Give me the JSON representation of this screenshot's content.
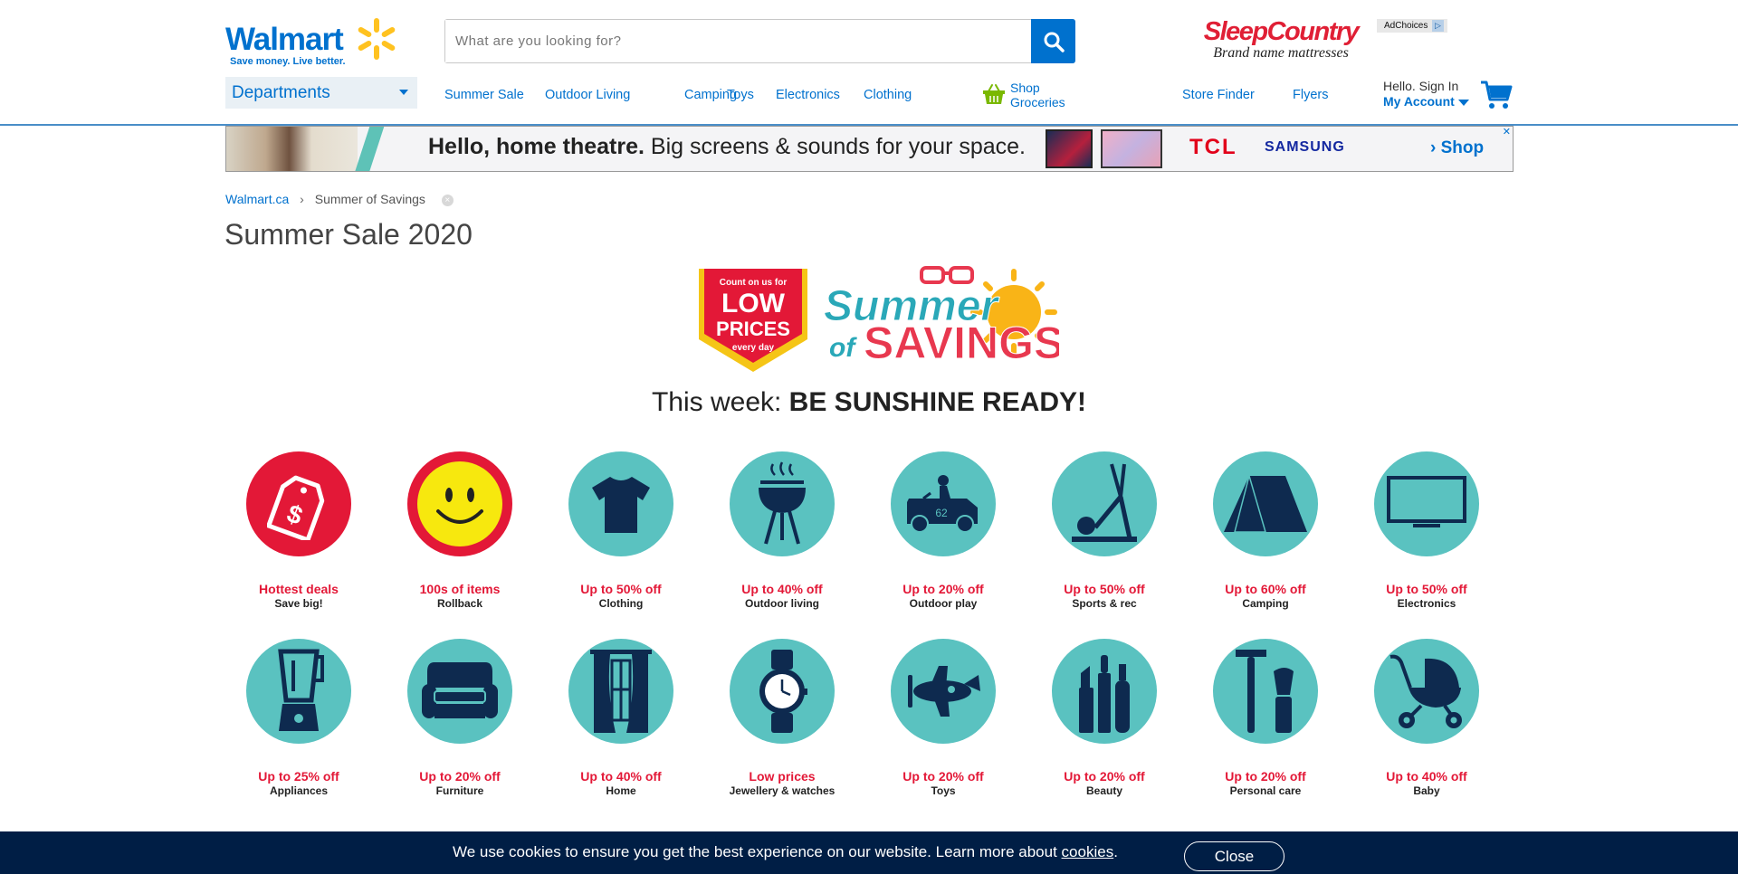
{
  "header": {
    "logo_text": "Walmart",
    "logo_tagline": "Save money. Live better.",
    "search_placeholder": "What are you looking for?",
    "departments_label": "Departments",
    "nav": [
      "Summer Sale",
      "Outdoor Living",
      "Camping",
      "Toys",
      "Electronics",
      "Clothing"
    ],
    "groceries_line1": "Shop",
    "groceries_line2": "Groceries",
    "store_finder": "Store Finder",
    "flyers": "Flyers",
    "account_hello": "Hello. Sign In",
    "account_link": "My Account"
  },
  "sleep_ad": {
    "brand": "SleepCountry",
    "tagline": "Brand name mattresses",
    "adchoices": "AdChoices"
  },
  "banner": {
    "headline_bold": "Hello, home theatre.",
    "headline_rest": " Big screens & sounds for your space.",
    "brand1": "TCL",
    "brand2": "SAMSUNG",
    "shop": "› Shop"
  },
  "breadcrumb": {
    "home": "Walmart.ca",
    "current": "Summer of Savings"
  },
  "page_title": "Summer Sale 2020",
  "hero": {
    "low_prices_top": "Count on us for",
    "low_prices_main1": "LOW",
    "low_prices_main2": "PRICES",
    "low_prices_bottom": "every day",
    "summer_line1": "Summer",
    "summer_line2a": "of",
    "summer_line2b": "SAVINGS"
  },
  "week": {
    "prefix": "This week: ",
    "highlight": "BE SUNSHINE READY!"
  },
  "categories": [
    {
      "deal": "Hottest deals",
      "name": "Save big!",
      "icon": "price-tag-icon",
      "color": "red"
    },
    {
      "deal": "100s of items",
      "name": "Rollback",
      "icon": "smiley-icon",
      "color": "red"
    },
    {
      "deal": "Up to 50% off",
      "name": "Clothing",
      "icon": "tshirt-icon",
      "color": "teal"
    },
    {
      "deal": "Up to 40% off",
      "name": "Outdoor living",
      "icon": "grill-icon",
      "color": "teal"
    },
    {
      "deal": "Up to 20% off",
      "name": "Outdoor play",
      "icon": "ride-on-car-icon",
      "color": "teal"
    },
    {
      "deal": "Up to 50% off",
      "name": "Sports & rec",
      "icon": "elliptical-icon",
      "color": "teal"
    },
    {
      "deal": "Up to 60% off",
      "name": "Camping",
      "icon": "tent-icon",
      "color": "teal"
    },
    {
      "deal": "Up to 50% off",
      "name": "Electronics",
      "icon": "tv-icon",
      "color": "teal"
    },
    {
      "deal": "Up to 25% off",
      "name": "Appliances",
      "icon": "blender-icon",
      "color": "teal"
    },
    {
      "deal": "Up to 20% off",
      "name": "Furniture",
      "icon": "armchair-icon",
      "color": "teal"
    },
    {
      "deal": "Up to 40% off",
      "name": "Home",
      "icon": "curtains-icon",
      "color": "teal"
    },
    {
      "deal": "Low prices",
      "name": "Jewellery & watches",
      "icon": "watch-icon",
      "color": "teal"
    },
    {
      "deal": "Up to 20% off",
      "name": "Toys",
      "icon": "toy-plane-icon",
      "color": "teal"
    },
    {
      "deal": "Up to 20% off",
      "name": "Beauty",
      "icon": "cosmetics-icon",
      "color": "teal"
    },
    {
      "deal": "Up to 20% off",
      "name": "Personal care",
      "icon": "razor-icon",
      "color": "teal"
    },
    {
      "deal": "Up to 40% off",
      "name": "Baby",
      "icon": "stroller-icon",
      "color": "teal"
    }
  ],
  "cookie": {
    "text": "We use cookies to ensure you get the best experience on our website. Learn more about ",
    "link": "cookies",
    "end": ".",
    "close": "Close"
  },
  "colors": {
    "brand_blue": "#0071ce",
    "deal_red": "#e31837",
    "teal": "#5ac2c0",
    "navy_icon": "#0e2a4f",
    "cookie_bg": "#001e45"
  }
}
